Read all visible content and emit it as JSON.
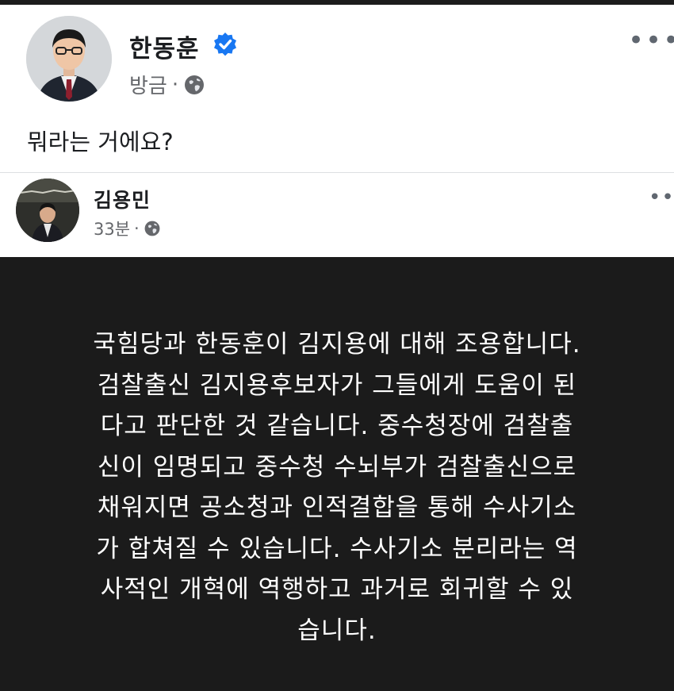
{
  "post": {
    "author": "한동훈",
    "timestamp": "방금",
    "separator": "·",
    "text": "뭐라는 거에요?",
    "more_glyph": "•••",
    "verified_icon": "verified-badge-icon",
    "privacy_icon": "globe-icon"
  },
  "shared_post": {
    "author": "김용민",
    "timestamp": "33분",
    "separator": "·",
    "more_glyph": "•••",
    "privacy_icon": "globe-icon",
    "card": {
      "background": "#1b1b1b",
      "lines": [
        "국힘당과 한동훈이 김지용에 대해 조용합니다.",
        "검찰출신 김지용후보자가 그들에게 도움이 된",
        "다고 판단한 것 같습니다. 중수청장에 검찰출",
        "신이 임명되고 중수청 수뇌부가 검찰출신으로",
        "채워지면 공소청과 인적결합을 통해 수사기소",
        "가 합쳐질 수 있습니다. 수사기소 분리라는 역",
        "사적인 개혁에 역행하고 과거로 회귀할 수 있",
        "습니다."
      ]
    }
  },
  "colors": {
    "verified_blue": "#1877f2",
    "secondary_text": "#65676b",
    "primary_text": "#1c1e21"
  }
}
